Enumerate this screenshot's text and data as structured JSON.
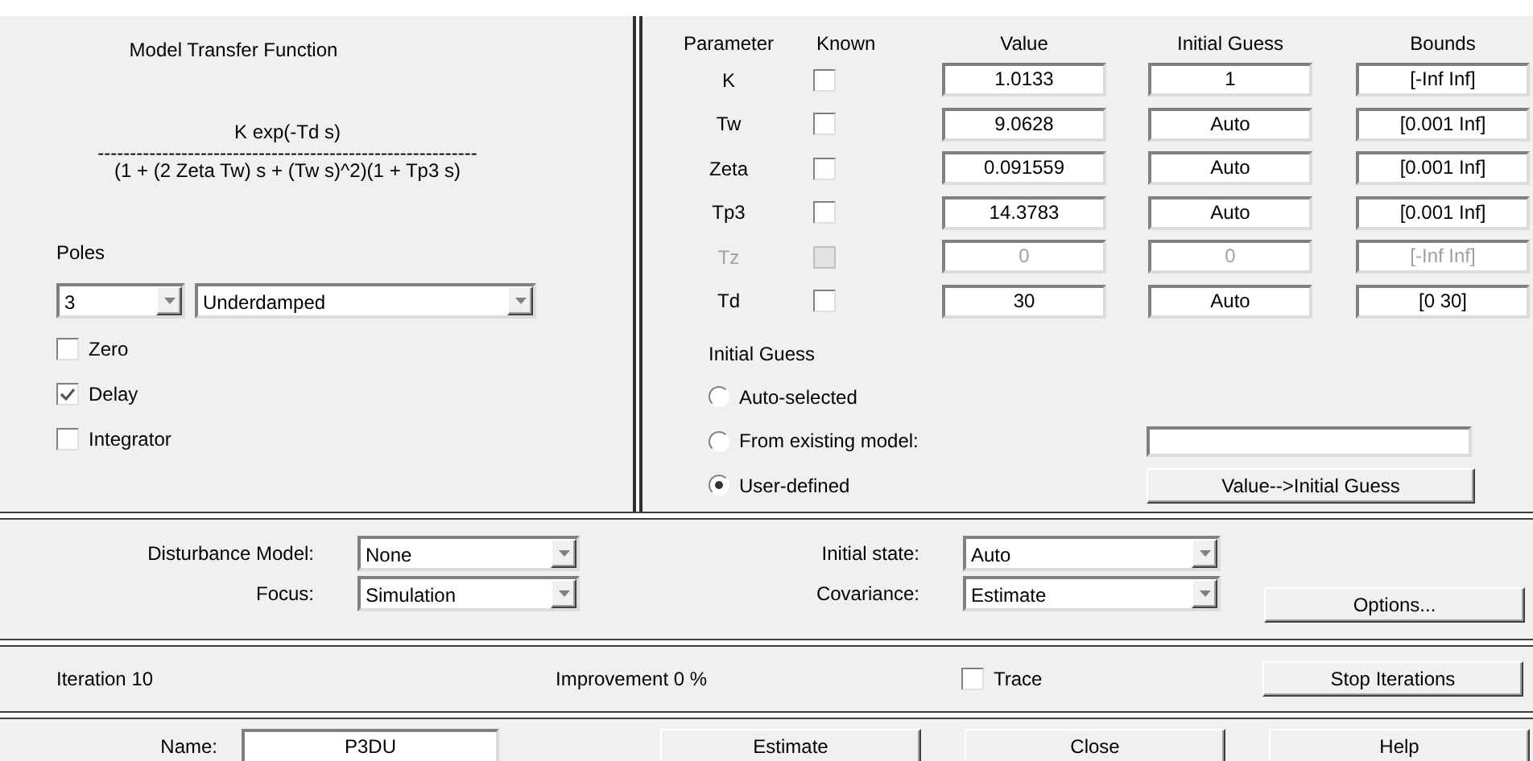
{
  "model": {
    "title": "Model Transfer Function",
    "numerator": "K exp(-Td s)",
    "divider": "-----------------------------------------------------------",
    "denominator": "(1 + (2 Zeta Tw) s + (Tw s)^2)(1 + Tp3 s)"
  },
  "poles": {
    "label": "Poles",
    "order": "3",
    "type": "Underdamped"
  },
  "structure_options": [
    {
      "label": "Zero",
      "checked": false
    },
    {
      "label": "Delay",
      "checked": true
    },
    {
      "label": "Integrator",
      "checked": false
    }
  ],
  "parameters": {
    "columns": [
      "Parameter",
      "Known",
      "Value",
      "Initial Guess",
      "Bounds"
    ],
    "rows": [
      {
        "name": "K",
        "known": false,
        "disabled": false,
        "value": "1.0133",
        "initial_guess": "1",
        "bounds": "[-Inf Inf]"
      },
      {
        "name": "Tw",
        "known": false,
        "disabled": false,
        "value": "9.0628",
        "initial_guess": "Auto",
        "bounds": "[0.001 Inf]"
      },
      {
        "name": "Zeta",
        "known": false,
        "disabled": false,
        "value": "0.091559",
        "initial_guess": "Auto",
        "bounds": "[0.001 Inf]"
      },
      {
        "name": "Tp3",
        "known": false,
        "disabled": false,
        "value": "14.3783",
        "initial_guess": "Auto",
        "bounds": "[0.001 Inf]"
      },
      {
        "name": "Tz",
        "known": false,
        "disabled": true,
        "value": "0",
        "initial_guess": "0",
        "bounds": "[-Inf Inf]"
      },
      {
        "name": "Td",
        "known": false,
        "disabled": false,
        "value": "30",
        "initial_guess": "Auto",
        "bounds": "[0 30]"
      }
    ]
  },
  "initial_guess": {
    "label": "Initial Guess",
    "options": [
      {
        "label": "Auto-selected",
        "selected": false
      },
      {
        "label": "From existing model:",
        "selected": false
      },
      {
        "label": "User-defined",
        "selected": true
      }
    ],
    "copy_button": "Value-->Initial Guess"
  },
  "settings": {
    "disturbance_model": {
      "label": "Disturbance Model:",
      "value": "None"
    },
    "focus": {
      "label": "Focus:",
      "value": "Simulation"
    },
    "initial_state": {
      "label": "Initial state:",
      "value": "Auto"
    },
    "covariance": {
      "label": "Covariance:",
      "value": "Estimate"
    },
    "options_button": "Options..."
  },
  "status": {
    "iteration": "Iteration 10",
    "improvement": "Improvement 0 %",
    "trace": {
      "label": "Trace",
      "checked": false
    },
    "stop_button": "Stop Iterations"
  },
  "footer": {
    "name_label": "Name:",
    "name_value": "P3DU",
    "buttons": [
      "Estimate",
      "Close",
      "Help"
    ]
  }
}
